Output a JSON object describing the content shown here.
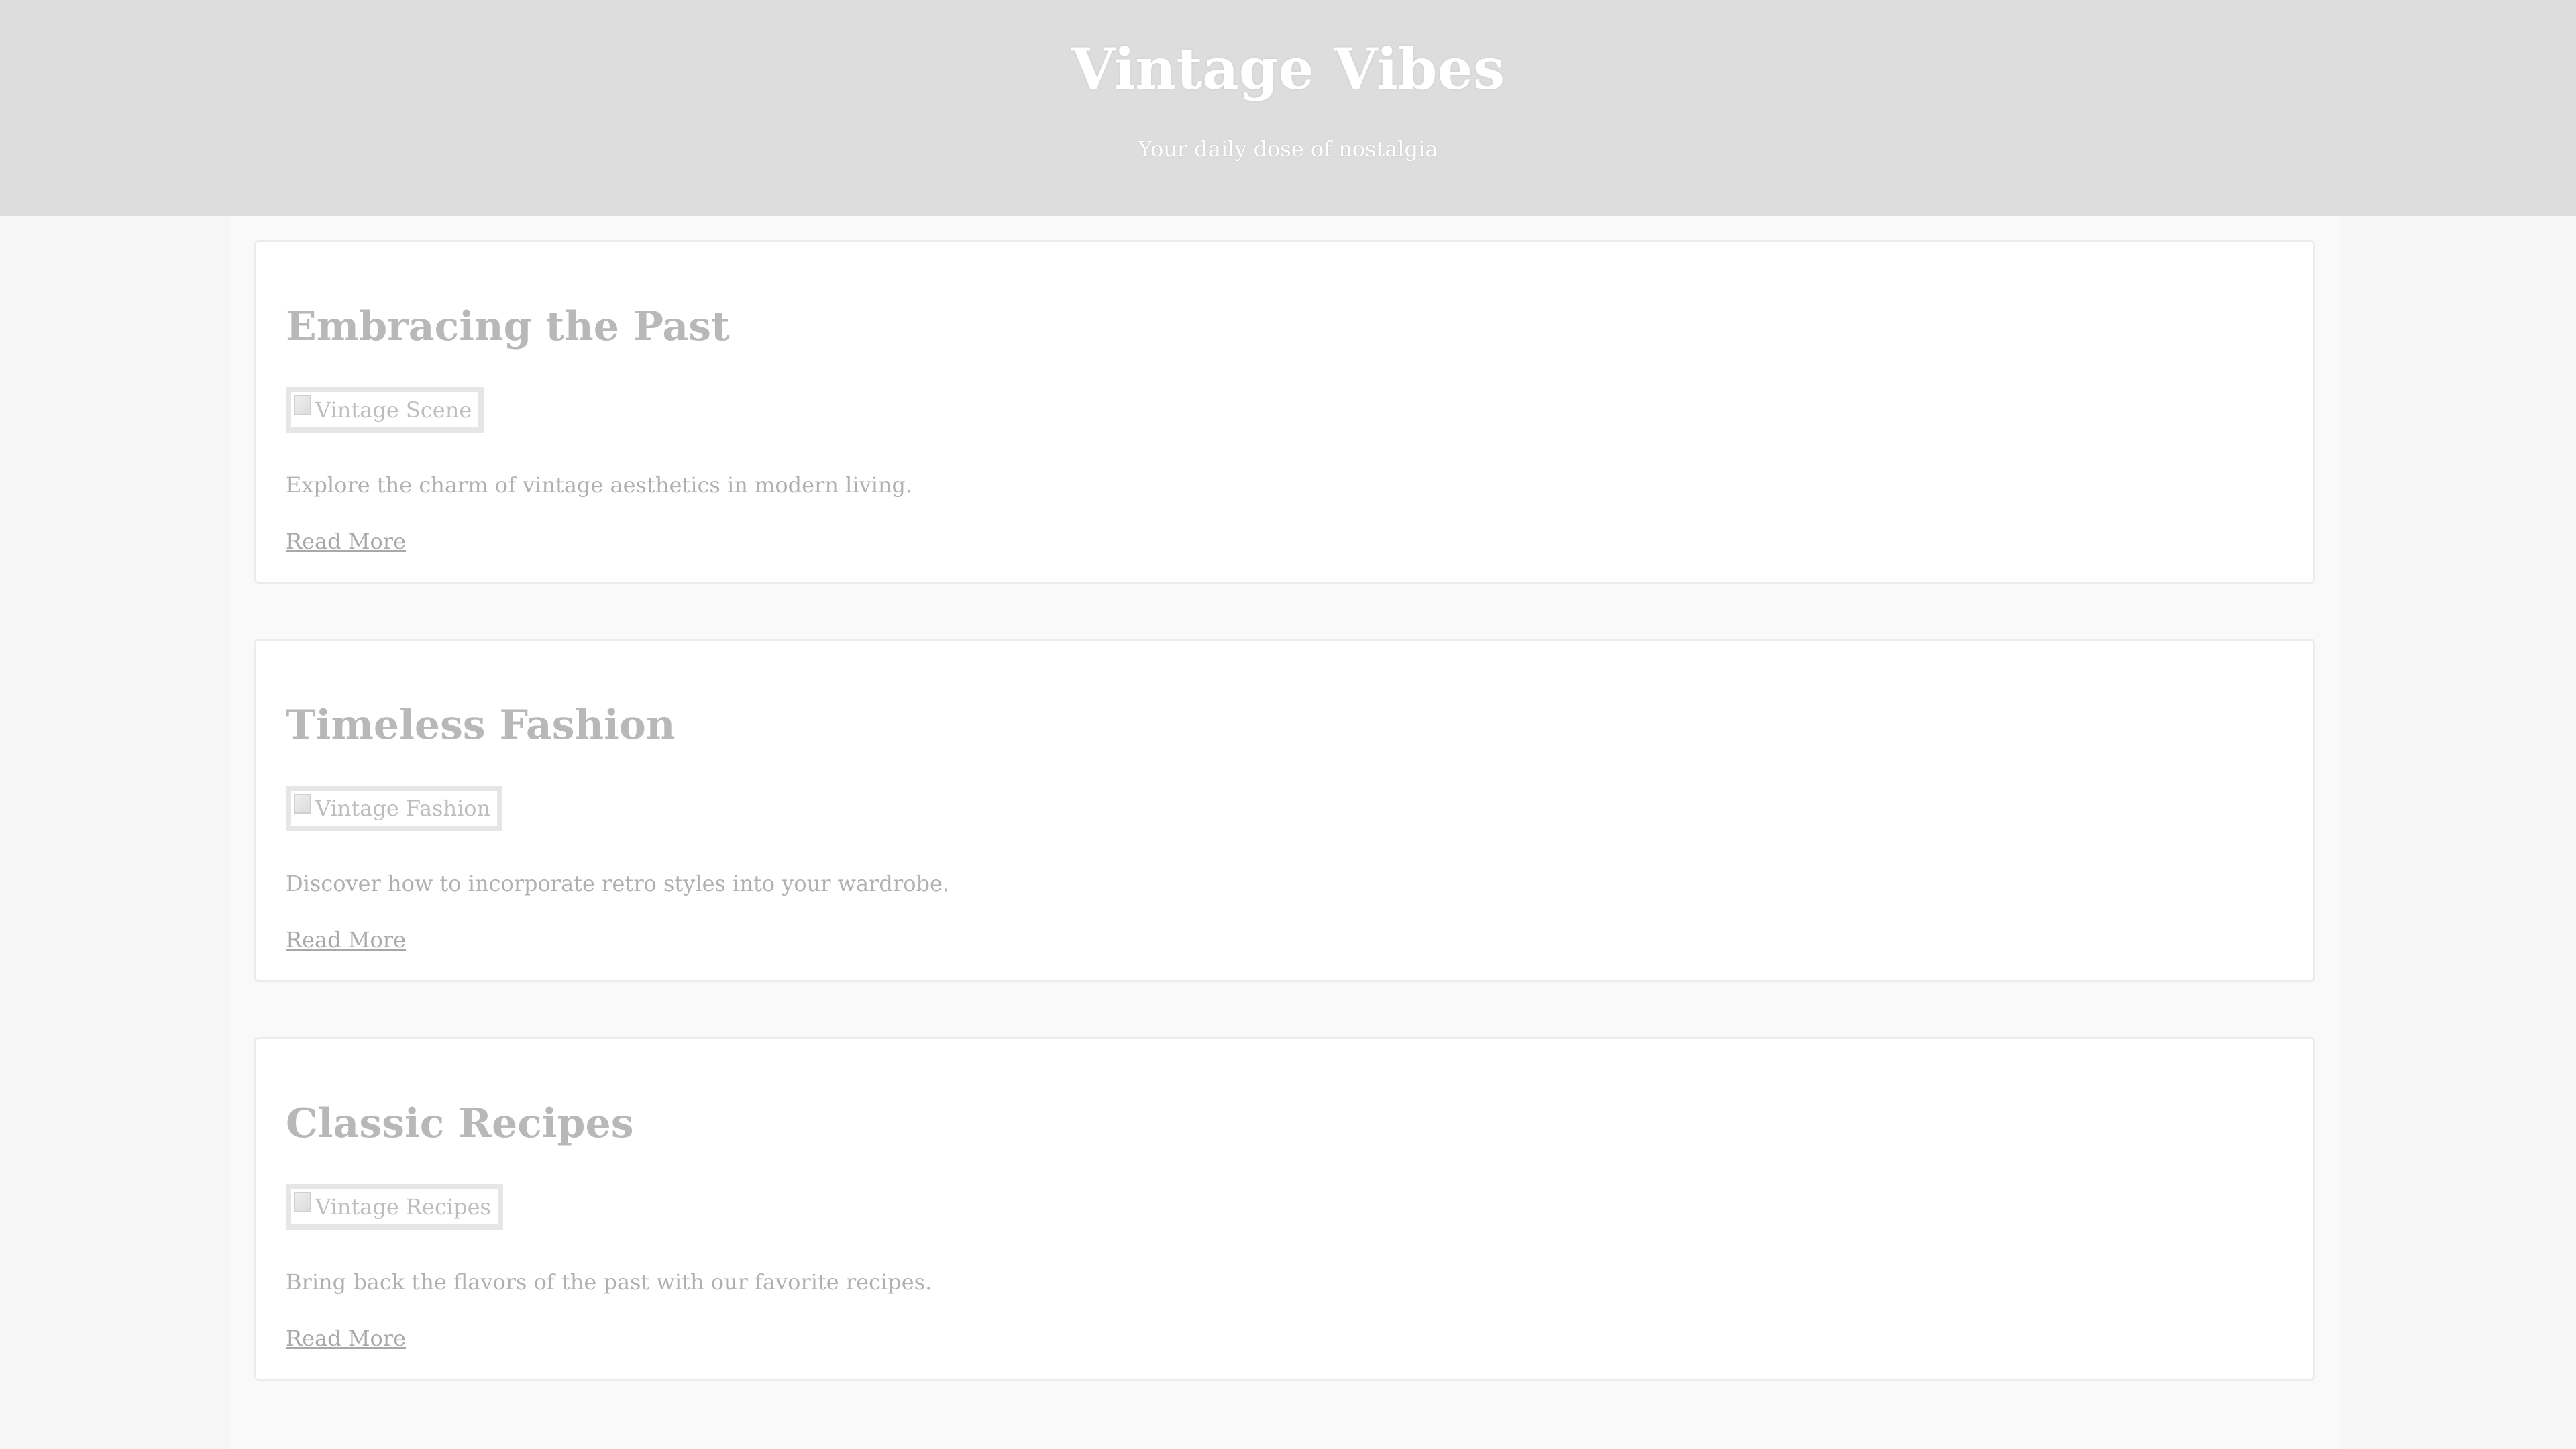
{
  "header": {
    "title": "Vintage Vibes",
    "tagline": "Your daily dose of nostalgia"
  },
  "articles": [
    {
      "title": "Embracing the Past",
      "image_alt": "Vintage Scene",
      "description": "Explore the charm of vintage aesthetics in modern living.",
      "link_label": "Read More"
    },
    {
      "title": "Timeless Fashion",
      "image_alt": "Vintage Fashion",
      "description": "Discover how to incorporate retro styles into your wardrobe.",
      "link_label": "Read More"
    },
    {
      "title": "Classic Recipes",
      "image_alt": "Vintage Recipes",
      "description": "Bring back the flavors of the past with our favorite recipes.",
      "link_label": "Read More"
    }
  ],
  "colors": {
    "header_bg": "#dddddd",
    "page_bg": "#f6f6f6",
    "card_bg": "#ffffff",
    "heading_text": "#b8b8b8",
    "body_text": "#b0b0b0"
  }
}
